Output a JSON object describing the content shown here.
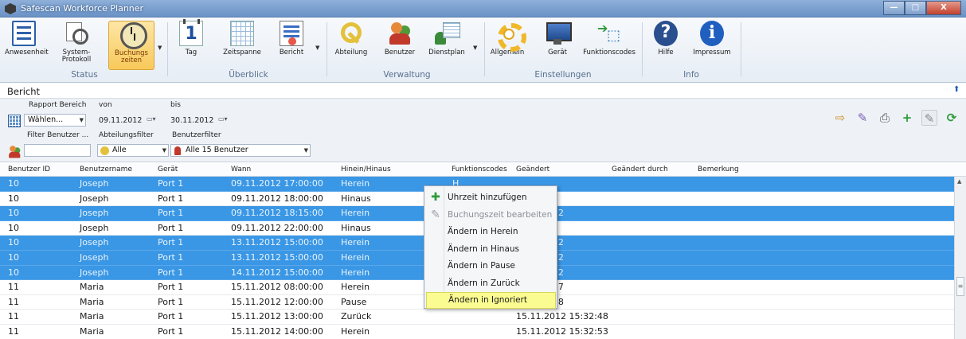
{
  "window": {
    "title": "Safescan Workforce Planner",
    "buttons": {
      "minimize": "—",
      "maximize": "□",
      "close": "X"
    }
  },
  "ribbon": {
    "groups": [
      {
        "label": "Status",
        "buttons": [
          {
            "label": "Anwesenheit",
            "icon": "list-icon"
          },
          {
            "label": "System-\nProtokoll",
            "icon": "search-document-icon"
          },
          {
            "label": "Buchungs\nzeiten",
            "icon": "clock-icon",
            "active": true
          }
        ]
      },
      {
        "label": "Überblick",
        "buttons": [
          {
            "label": "Tag",
            "icon": "calendar-day-icon"
          },
          {
            "label": "Zeitspanne",
            "icon": "calendar-grid-icon"
          },
          {
            "label": "Bericht",
            "icon": "report-icon"
          }
        ]
      },
      {
        "label": "Verwaltung",
        "buttons": [
          {
            "label": "Abteilung",
            "icon": "key-icon"
          },
          {
            "label": "Benutzer",
            "icon": "users-icon"
          },
          {
            "label": "Dienstplan",
            "icon": "shift-schedule-icon"
          }
        ]
      },
      {
        "label": "Einstellungen",
        "buttons": [
          {
            "label": "Allgemein",
            "icon": "gear-icon"
          },
          {
            "label": "Gerät",
            "icon": "monitor-icon"
          },
          {
            "label": "Funktionscodes",
            "icon": "codes-icon"
          }
        ]
      },
      {
        "label": "Info",
        "buttons": [
          {
            "label": "Hilfe",
            "icon": "help-icon"
          },
          {
            "label": "Impressum",
            "icon": "info-icon"
          }
        ]
      }
    ]
  },
  "panel": {
    "title": "Bericht",
    "filters": {
      "rapport_label": "Rapport Bereich",
      "rapport_value": "Wählen...",
      "von_label": "von",
      "von_value": "09.11.2012",
      "bis_label": "bis",
      "bis_value": "30.11.2012",
      "filter_user_label": "Filter Benutzer ...",
      "filter_user_value": "",
      "abteilung_label": "Abteilungsfilter",
      "abteilung_value": "Alle",
      "benutzer_label": "Benutzerfilter",
      "benutzer_value": "Alle 15 Benutzer"
    }
  },
  "grid": {
    "columns": [
      "Benutzer ID",
      "Benutzername",
      "Gerät",
      "Wann",
      "Hinein/Hinaus",
      "Funktionscodes",
      "Geändert",
      "Geändert durch",
      "Bemerkung"
    ],
    "rows": [
      {
        "id": "10",
        "name": "Joseph",
        "device": "Port 1",
        "when": "09.11.2012 17:00:00",
        "inout": "Herein",
        "code": "H",
        "changed": "",
        "selected": true
      },
      {
        "id": "10",
        "name": "Joseph",
        "device": "Port 1",
        "when": "09.11.2012 18:00:00",
        "inout": "Hinaus",
        "code": "",
        "changed": "",
        "selected": false
      },
      {
        "id": "10",
        "name": "Joseph",
        "device": "Port 1",
        "when": "09.11.2012 18:15:00",
        "inout": "Herein",
        "code": "",
        "changed": "2 12:49:12",
        "selected": true
      },
      {
        "id": "10",
        "name": "Joseph",
        "device": "Port 1",
        "when": "09.11.2012 22:00:00",
        "inout": "Hinaus",
        "code": "",
        "changed": "",
        "selected": false
      },
      {
        "id": "10",
        "name": "Joseph",
        "device": "Port 1",
        "when": "13.11.2012 15:00:00",
        "inout": "Herein",
        "code": "",
        "changed": "2 13:48:32",
        "selected": true
      },
      {
        "id": "10",
        "name": "Joseph",
        "device": "Port 1",
        "when": "13.11.2012 15:00:00",
        "inout": "Herein",
        "code": "",
        "changed": "2 13:48:32",
        "selected": true
      },
      {
        "id": "10",
        "name": "Joseph",
        "device": "Port 1",
        "when": "14.11.2012 15:00:00",
        "inout": "Herein",
        "code": "",
        "changed": "2 13:48:32",
        "selected": true
      },
      {
        "id": "11",
        "name": "Maria",
        "device": "Port 1",
        "when": "15.11.2012 08:00:00",
        "inout": "Herein",
        "code": "",
        "changed": "2 15:10:37",
        "selected": false
      },
      {
        "id": "11",
        "name": "Maria",
        "device": "Port 1",
        "when": "15.11.2012 12:00:00",
        "inout": "Pause",
        "code": "",
        "changed": "2 15:32:38",
        "selected": false
      },
      {
        "id": "11",
        "name": "Maria",
        "device": "Port 1",
        "when": "15.11.2012 13:00:00",
        "inout": "Zurück",
        "code": "",
        "changed": "15.11.2012 15:32:48",
        "selected": false
      },
      {
        "id": "11",
        "name": "Maria",
        "device": "Port 1",
        "when": "15.11.2012 14:00:00",
        "inout": "Herein",
        "code": "",
        "changed": "15.11.2012 15:32:53",
        "selected": false
      }
    ]
  },
  "context_menu": {
    "items": [
      {
        "label": "Uhrzeit hinzufügen",
        "icon": "plus-icon",
        "disabled": false,
        "highlighted": false
      },
      {
        "label": "Buchungszeit bearbeiten",
        "icon": "edit-icon",
        "disabled": true,
        "highlighted": false
      },
      {
        "label": "Ändern in Herein",
        "icon": "",
        "disabled": false,
        "highlighted": false
      },
      {
        "label": "Ändern in Hinaus",
        "icon": "",
        "disabled": false,
        "highlighted": false
      },
      {
        "label": "Ändern in Pause",
        "icon": "",
        "disabled": false,
        "highlighted": false
      },
      {
        "label": "Ändern in Zurück",
        "icon": "",
        "disabled": false,
        "highlighted": false
      },
      {
        "label": "Ändern in Ignoriert",
        "icon": "",
        "disabled": false,
        "highlighted": true
      }
    ]
  },
  "colors": {
    "selection": "#3a97e5",
    "highlight": "#fafc92",
    "active_ribbon": "#f8c95a"
  }
}
